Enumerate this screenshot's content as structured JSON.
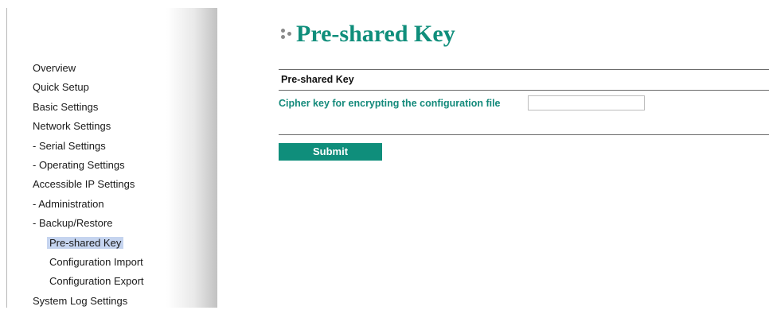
{
  "sidebar": {
    "items": [
      {
        "label": "Overview",
        "level": 0,
        "active": false
      },
      {
        "label": "Quick Setup",
        "level": 0,
        "active": false
      },
      {
        "label": "Basic Settings",
        "level": 0,
        "active": false
      },
      {
        "label": "Network Settings",
        "level": 0,
        "active": false
      },
      {
        "label": "- Serial Settings",
        "level": 0,
        "active": false
      },
      {
        "label": "- Operating Settings",
        "level": 0,
        "active": false
      },
      {
        "label": "Accessible IP Settings",
        "level": 0,
        "active": false
      },
      {
        "label": "- Administration",
        "level": 0,
        "active": false
      },
      {
        "label": "- Backup/Restore",
        "level": 0,
        "active": false
      },
      {
        "label": "Pre-shared Key",
        "level": 1,
        "active": true
      },
      {
        "label": "Configuration Import",
        "level": 1,
        "active": false
      },
      {
        "label": "Configuration Export",
        "level": 1,
        "active": false
      },
      {
        "label": "System Log Settings",
        "level": 0,
        "active": false
      }
    ]
  },
  "main": {
    "page_title": "Pre-shared Key",
    "section_title": "Pre-shared Key",
    "cipher_field": {
      "label": "Cipher key for encrypting the configuration file",
      "value": "",
      "placeholder": ""
    },
    "submit_label": "Submit"
  },
  "colors": {
    "accent": "#0f8e7b",
    "label": "#148a7b",
    "nav_highlight": "#c5d4ef"
  },
  "icons": {
    "title_bullet": "dots-icon"
  }
}
